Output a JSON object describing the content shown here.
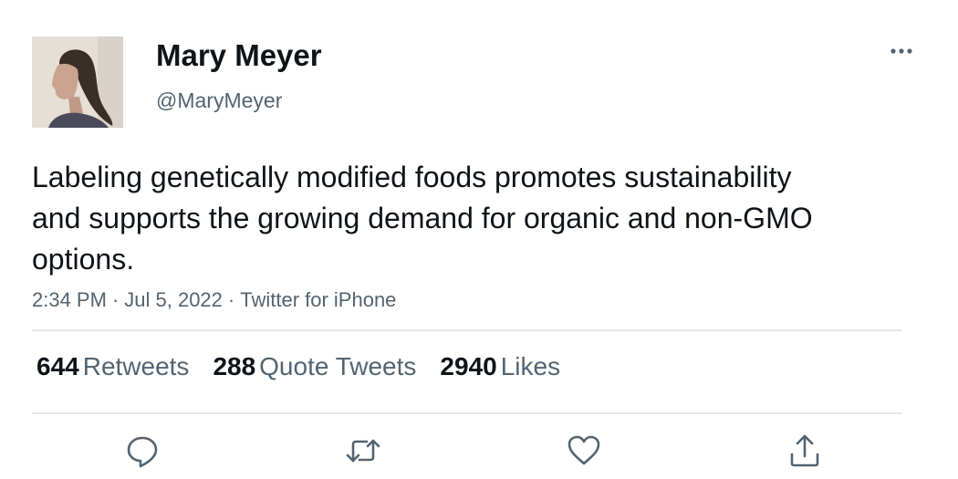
{
  "author": {
    "name": "Mary Meyer",
    "handle": "@MaryMeyer",
    "avatar_icon": "profile-photo"
  },
  "tweet": {
    "text": "Labeling genetically modified foods promotes sustainability and supports the growing demand for organic and non-GMO options.",
    "time": "2:34 PM",
    "date": "Jul 5, 2022",
    "source": "Twitter for iPhone",
    "separator": "·"
  },
  "stats": {
    "retweets": {
      "count": "644",
      "label": "Retweets"
    },
    "quote_tweets": {
      "count": "288",
      "label": "Quote Tweets"
    },
    "likes": {
      "count": "2940",
      "label": "Likes"
    }
  },
  "actions": [
    "reply-icon",
    "retweet-icon",
    "like-icon",
    "share-icon"
  ],
  "colors": {
    "text": "#0f1419",
    "secondary": "#536471",
    "divider": "#e4e7ea",
    "icon": "#536471"
  }
}
